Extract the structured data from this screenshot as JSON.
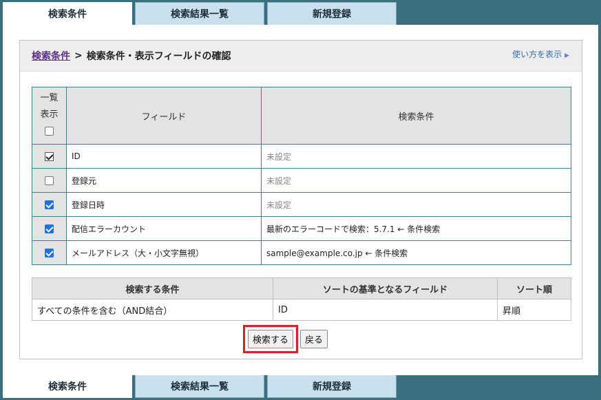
{
  "tabs": [
    "検索条件",
    "検索結果一覧",
    "新規登録"
  ],
  "breadcrumb": {
    "link": "検索条件",
    "sep": ">",
    "current": "検索条件・表示フィールドの確認"
  },
  "help": {
    "label": "使い方を表示",
    "arrow": "▶"
  },
  "fields_table": {
    "head_show_1": "一覧",
    "head_show_2": "表示",
    "head_field": "フィールド",
    "head_condition": "検索条件",
    "rows": [
      {
        "field": "ID",
        "condition": "未設定",
        "checked": true
      },
      {
        "field": "登録元",
        "condition": "未設定",
        "checked": false
      },
      {
        "field": "登録日時",
        "condition": "未設定",
        "checked": true
      },
      {
        "field": "配信エラーカウント",
        "condition": "最新のエラーコードで検索：5.7.1 ← 条件検索",
        "checked": true
      },
      {
        "field": "メールアドレス（大・小文字無視）",
        "condition": "sample@example.co.jp ← 条件検索",
        "checked": true
      }
    ]
  },
  "sort_table": {
    "headers": [
      "検索する条件",
      "ソートの基準となるフィールド",
      "ソート順"
    ],
    "row": [
      "すべての条件を含む（AND結合）",
      "ID",
      "昇順"
    ]
  },
  "buttons": {
    "search": "検索する",
    "back": "戻る"
  },
  "colors": {
    "accent_blue": "#1a73e8",
    "highlight_red": "#e02020",
    "link_purple": "#5a2d8c"
  }
}
